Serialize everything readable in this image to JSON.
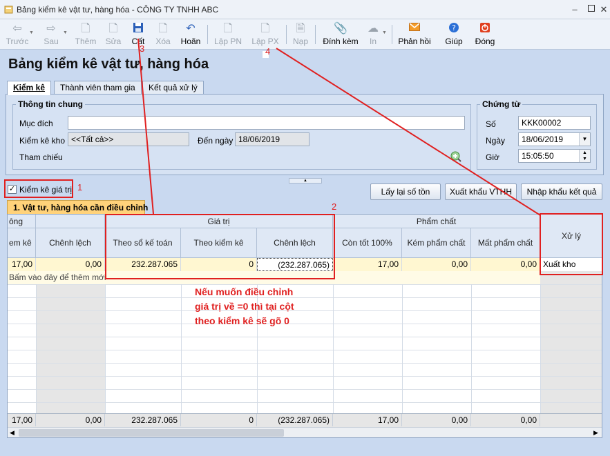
{
  "window": {
    "title": "Bảng kiểm kê vật tư, hàng hóa - CÔNG TY TNHH ABC",
    "minimize_glyph": "–",
    "close_glyph": "✕"
  },
  "toolbar": {
    "back": "Trước",
    "next": "Sau",
    "add": "Thêm",
    "edit": "Sửa",
    "save": "Cất",
    "delete": "Xóa",
    "undo": "Hoãn",
    "create_receipt": "Lập PN",
    "create_issue": "Lập PX",
    "load": "Nạp",
    "attach": "Đính kèm",
    "print": "In",
    "feedback": "Phản hồi",
    "help": "Giúp",
    "close": "Đóng"
  },
  "page": {
    "heading": "Bảng kiểm kê vật tư, hàng hóa"
  },
  "tabs": {
    "inventory": "Kiểm kê",
    "members": "Thành viên tham gia",
    "results": "Kết quả xử lý"
  },
  "general_info": {
    "legend": "Thông tin chung",
    "purpose_label": "Mục đích",
    "purpose_value": "",
    "warehouse_label": "Kiểm kê kho",
    "warehouse_value": "<<Tất cả>>",
    "to_date_label": "Đến ngày",
    "to_date_value": "18/06/2019",
    "reference_label": "Tham chiếu"
  },
  "voucher": {
    "legend": "Chứng từ",
    "number_label": "Số",
    "number_value": "KKK00002",
    "date_label": "Ngày",
    "date_value": "18/06/2019",
    "time_label": "Giờ",
    "time_value": "15:05:50"
  },
  "options": {
    "value_check_label": "Kiểm kê giá trị",
    "value_check_checked": true
  },
  "actions": {
    "reload_stock": "Lấy lại số tồn",
    "export_vthh": "Xuất khẩu VTHH",
    "import_results": "Nhập khẩu kết quả"
  },
  "grid": {
    "tab_label": "1. Vật tư, hàng hóa cần điều chỉnh",
    "group_headers": {
      "left_partial": "ông",
      "value": "Giá trị",
      "quality": "Phẩm chất",
      "handling": "Xử lý"
    },
    "columns": {
      "col_partial": "em kê",
      "difference": "Chênh lệch",
      "per_books": "Theo sổ kế toán",
      "per_count": "Theo kiểm kê",
      "value_difference": "Chênh lệch",
      "good": "Còn tốt 100%",
      "degraded": "Kém phẩm chất",
      "lost_quality": "Mất phẩm chất"
    },
    "row": {
      "col_partial": "17,00",
      "difference": "0,00",
      "per_books": "232.287.065",
      "per_count": "0",
      "value_difference": "(232.287.065)",
      "good": "17,00",
      "degraded": "0,00",
      "lost_quality": "0,00",
      "handling": "Xuất kho"
    },
    "add_row_hint": "Bấm vào đây để thêm mới",
    "footer": {
      "col_partial": "17,00",
      "difference": "0,00",
      "per_books": "232.287.065",
      "per_count": "0",
      "value_difference": "(232.287.065)",
      "good": "17,00",
      "degraded": "0,00",
      "lost_quality": "0,00"
    }
  },
  "annotations": {
    "n1": "1",
    "n2": "2",
    "n3": "3",
    "n4": "4",
    "note": "Nếu muốn điều chỉnh\ngiá trị về =0 thì tại cột\ntheo kiểm kê sẽ gõ 0",
    "color": "#e02020"
  },
  "icons": {
    "back": "arrow-left-icon",
    "next": "arrow-right-icon",
    "add": "new-doc-icon",
    "edit": "edit-doc-icon",
    "save": "save-icon",
    "delete": "delete-icon",
    "undo": "undo-icon",
    "receipt": "receipt-icon",
    "issue": "issue-icon",
    "load": "load-icon",
    "attach": "paperclip-icon",
    "print": "print-icon",
    "feedback": "envelope-icon",
    "help": "help-icon",
    "close": "power-icon",
    "reference": "search-add-icon"
  }
}
